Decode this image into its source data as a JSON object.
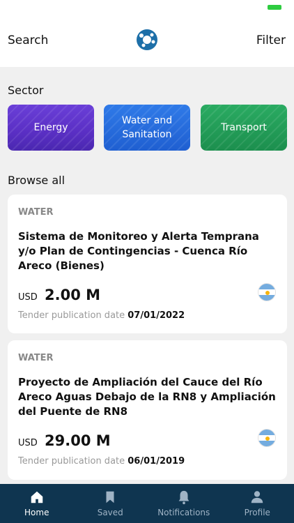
{
  "header": {
    "search_label": "Search",
    "filter_label": "Filter"
  },
  "sectors": {
    "title": "Sector",
    "items": [
      {
        "label": "Energy"
      },
      {
        "label": "Water and\nSanitation"
      },
      {
        "label": "Transport"
      }
    ]
  },
  "browse": {
    "title": "Browse all",
    "cards": [
      {
        "kind": "WATER",
        "title": "Sistema de Monitoreo y Alerta Temprana y/o Plan de Contingencias - Cuenca Río Areco (Bienes)",
        "currency": "USD",
        "amount": "2.00 M",
        "date_label": "Tender publication date",
        "date": "07/01/2022"
      },
      {
        "kind": "WATER",
        "title": "Proyecto de Ampliación del Cauce del Río Areco Aguas Debajo de la RN8 y Ampliación del Puente de RN8",
        "currency": "USD",
        "amount": "29.00 M",
        "date_label": "Tender publication date",
        "date": "06/01/2019"
      }
    ]
  },
  "tabs": [
    {
      "label": "Home",
      "icon": "home-icon",
      "active": true
    },
    {
      "label": "Saved",
      "icon": "bookmark-icon",
      "active": false
    },
    {
      "label": "Notifications",
      "icon": "bell-icon",
      "active": false
    },
    {
      "label": "Profile",
      "icon": "person-icon",
      "active": false
    }
  ],
  "colors": {
    "tabbar": "#0f3550",
    "accent": "#1d6fa8"
  }
}
